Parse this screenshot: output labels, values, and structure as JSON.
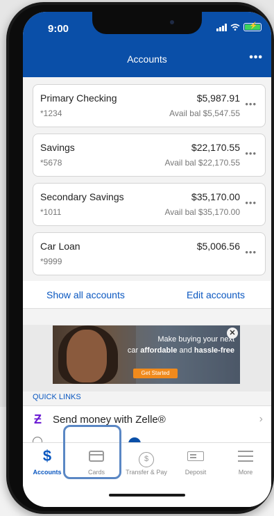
{
  "status_bar": {
    "time": "9:00"
  },
  "header": {
    "title": "Accounts",
    "more": "•••"
  },
  "accounts": [
    {
      "name": "Primary Checking",
      "number": "*1234",
      "balance": "$5,987.91",
      "available": "Avail bal $5,547.55"
    },
    {
      "name": "Savings",
      "number": "*5678",
      "balance": "$22,170.55",
      "available": "Avail bal $22,170.55"
    },
    {
      "name": "Secondary Savings",
      "number": "*1011",
      "balance": "$35,170.00",
      "available": "Avail bal $35,170.00"
    },
    {
      "name": "Car Loan",
      "number": "*9999",
      "balance": "$5,006.56",
      "available": ""
    }
  ],
  "account_more": "•••",
  "links": {
    "show_all": "Show all accounts",
    "edit": "Edit accounts"
  },
  "banner": {
    "text_1": "Make buying your next",
    "text_2": "car",
    "text_3": "affordable",
    "text_4": "and",
    "text_5": "hassle-free",
    "button": "Get Started",
    "close": "✕"
  },
  "quick_links": {
    "header": "QUICK LINKS",
    "zelle_icon": "Ƶ",
    "zelle_label": "Send money with Zelle®",
    "chevron": "›"
  },
  "tabs": [
    {
      "label": "Accounts",
      "icon": "dollar-icon",
      "glyph": "$",
      "active": true
    },
    {
      "label": "Cards",
      "icon": "card-icon",
      "active": false
    },
    {
      "label": "Transfer & Pay",
      "icon": "transfer-icon",
      "glyph": "$",
      "active": false
    },
    {
      "label": "Deposit",
      "icon": "check-deposit-icon",
      "active": false
    },
    {
      "label": "More",
      "icon": "menu-icon",
      "active": false
    }
  ],
  "colors": {
    "brand": "#0a4fa8",
    "link": "#0a57c0",
    "zelle": "#6d1ed4",
    "banner_button": "#f08a1c",
    "highlight": "#5a87c4"
  }
}
